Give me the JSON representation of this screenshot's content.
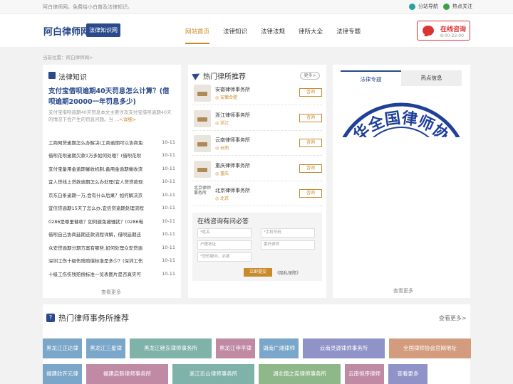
{
  "topbar": {
    "welcome": "阿白律师网，免费给小白普及法律知识。",
    "links": [
      {
        "label": "分站导航",
        "color": "#2aa0a0"
      },
      {
        "label": "热点关注",
        "color": "#3aa04a"
      }
    ]
  },
  "header": {
    "logo": "阿白律师网",
    "badge": "法律知识网",
    "nav": [
      "网站首页",
      "法律知识",
      "法律法规",
      "律所大全",
      "法律专题"
    ],
    "consult_title": "在线咨询",
    "consult_hours": "8:00-22:00"
  },
  "breadcrumb": "当前位置：阿白律师网>",
  "knowledge": {
    "title": "法律知识",
    "headline": "支付宝借呗逾期40天罚息怎么计算？(借呗逾期20000一年罚息多少)",
    "summary": "支付宝借呗逾期40天罚息本文主要涉及支付宝借呗逾期40天的情况下会产生的罚息问题。当 ...",
    "summary_more": "<详细>",
    "news": [
      {
        "title": "工商网贷逾期怎么办解决(工商逾期可以协商免",
        "date": "10-11"
      },
      {
        "title": "借呗花呗逾期欠款1万多如何处理？(借呗花呗",
        "date": "10-11"
      },
      {
        "title": "支付宝备用金逾期催收机制,备用金逾期催收流",
        "date": "10-11"
      },
      {
        "title": "宜人贷线上贷款逾期怎么办处理(宜人贷贷款现",
        "date": "10-11"
      },
      {
        "title": "京东白条逾期一万,会有什么后果？如何解决京",
        "date": "10-11"
      },
      {
        "title": "宜信贷逾期15天了怎么办,宜信贷逾期处理流程",
        "date": "10-11"
      },
      {
        "title": "0286是哪里催收？如何避免被骚扰？(0286电",
        "date": "10-11"
      },
      {
        "title": "借呗自己协商延期还款流程详解，借呗延期还",
        "date": "10-11"
      },
      {
        "title": "众安贷逾期分期方案有哪些,如何处理众安贷逾",
        "date": "10-11"
      },
      {
        "title": "深圳工伤十级伤残赔偿标准是多少？(深圳工伤",
        "date": "10-11"
      },
      {
        "title": "十级工伤伤残赔偿标准一览表图片是否真实可",
        "date": "10-11"
      }
    ],
    "see_more": "查看更多"
  },
  "lawfirms": {
    "title": "热门律所推荐",
    "more": "更多>",
    "button": "咨询",
    "items": [
      {
        "name": "安徽律师事务所",
        "location": "安徽合肥"
      },
      {
        "name": "浙江律师事务所",
        "location": "浙江"
      },
      {
        "name": "云南律师事务所",
        "location": "云南"
      },
      {
        "name": "重庆律师事务所",
        "location": "重庆"
      },
      {
        "name": "北京律师事务所",
        "location": "北京",
        "img_alt": "北京律师事务所"
      }
    ]
  },
  "consult_form": {
    "title": "在线咨询有问必答",
    "name_placeholder": "*姓名",
    "phone_placeholder": "*手机号码",
    "address_placeholder": "户籍地址",
    "fee_placeholder": "委托律师",
    "question_placeholder": "*您的疑问，必填",
    "submit": "立即提交",
    "privacy": "《隐私保障》"
  },
  "topics": {
    "tabs": [
      "法律专题",
      "热点信息"
    ],
    "seal_text": "中华全国律师协会",
    "see_more": "查看更多"
  },
  "hot_firms": {
    "title": "热门律师事务所推荐",
    "more": "查看更多>",
    "tags": [
      {
        "label": "黑龙江正达律",
        "color": "#7aa6c9"
      },
      {
        "label": "黑龙江三星律",
        "color": "#7aa6c9"
      },
      {
        "label": "黑龙江继东律师事务所",
        "color": "#7fb2a9"
      },
      {
        "label": "黑龙江申平律",
        "color": "#c08aa4"
      },
      {
        "label": "湖南广湘律师",
        "color": "#7aa6c9"
      },
      {
        "label": "云南灵源律师事务所",
        "color": "#8f93c8"
      },
      {
        "label": "全国律师协会官网地址",
        "color": "#d39c7e"
      },
      {
        "label": "福建欣开元律",
        "color": "#7aa6c9"
      },
      {
        "label": "福建启新律师事务所",
        "color": "#c08aa4"
      },
      {
        "label": "浙江近山律师事务所",
        "color": "#7fb2a9"
      },
      {
        "label": "湖北慎之宪律师事务所",
        "color": "#8fb88a"
      },
      {
        "label": "云南恒序律师",
        "color": "#c08aa4"
      },
      {
        "label": "查看更多",
        "color": "#8f93c8"
      }
    ]
  }
}
